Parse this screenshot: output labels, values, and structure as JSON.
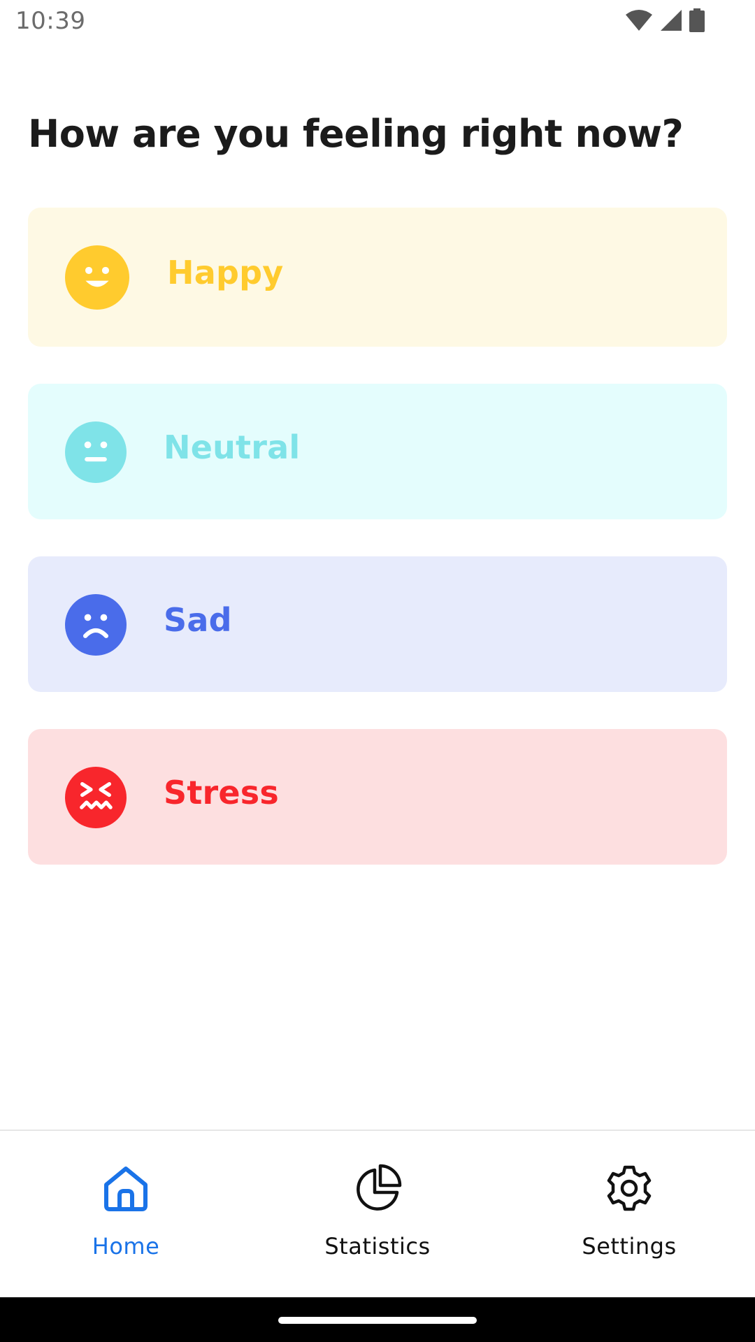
{
  "status_bar": {
    "time": "10:39",
    "icons": [
      "wifi-icon",
      "signal-icon",
      "battery-icon"
    ]
  },
  "page": {
    "title": "How are you feeling right now?"
  },
  "moods": [
    {
      "label": "Happy",
      "icon": "happy-face-icon",
      "text_color": "#FFCB2E",
      "bg_color": "#FEF9E4",
      "face_color": "#FFCB2E"
    },
    {
      "label": "Neutral",
      "icon": "neutral-face-icon",
      "text_color": "#7FE3E8",
      "bg_color": "#E4FDFD",
      "face_color": "#7FE3E8"
    },
    {
      "label": "Sad",
      "icon": "sad-face-icon",
      "text_color": "#4A6CEA",
      "bg_color": "#E7EBFC",
      "face_color": "#4A6CEA"
    },
    {
      "label": "Stress",
      "icon": "stressed-face-icon",
      "text_color": "#F8262C",
      "bg_color": "#FDDFE0",
      "face_color": "#F8262C"
    }
  ],
  "bottom_nav": {
    "active_color": "#1A73E8",
    "inactive_color": "#111111",
    "items": [
      {
        "label": "Home",
        "icon": "home-icon",
        "active": true
      },
      {
        "label": "Statistics",
        "icon": "pie-chart-icon",
        "active": false
      },
      {
        "label": "Settings",
        "icon": "gear-icon",
        "active": false
      }
    ]
  }
}
